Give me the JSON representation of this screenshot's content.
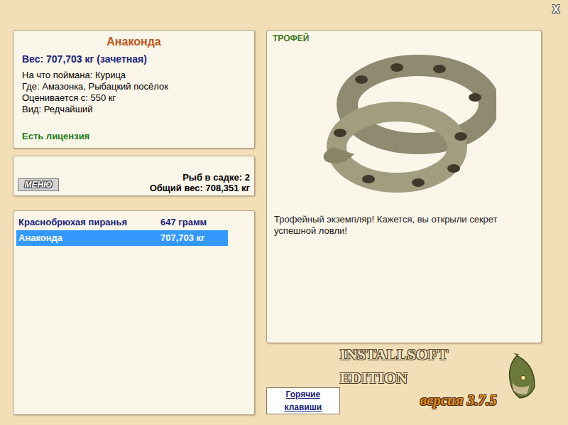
{
  "window": {
    "close": "X"
  },
  "catch": {
    "name": "Анаконда",
    "weight": "Вес: 707,703 кг (зачетная)",
    "details": [
      "На что поймана: Курица",
      "Где: Амазонка, Рыбацкий посёлок",
      "Оценивается с: 550 кг",
      "Вид: Редчайший"
    ],
    "license": "Есть лицензия"
  },
  "keepnet": {
    "menu_button": "МЕНЮ",
    "count": "Рыб в садке: 2",
    "total": "Общий вес: 708,351 кг"
  },
  "fish_list": [
    {
      "name": "Краснобрюхая пиранья",
      "weight": "647 грамм",
      "selected": false
    },
    {
      "name": "Анаконда",
      "weight": "707,703 кг",
      "selected": true
    }
  ],
  "trophy": {
    "badge": "ТРОФЕЙ",
    "message": "Трофейный экземпляр! Кажется, вы открыли секрет успешной ловли!"
  },
  "branding": {
    "edition": "INSTALLSOFT EDITION",
    "version": "версия 3.7.5"
  },
  "hotkeys_button": "Горячие клавиши"
}
